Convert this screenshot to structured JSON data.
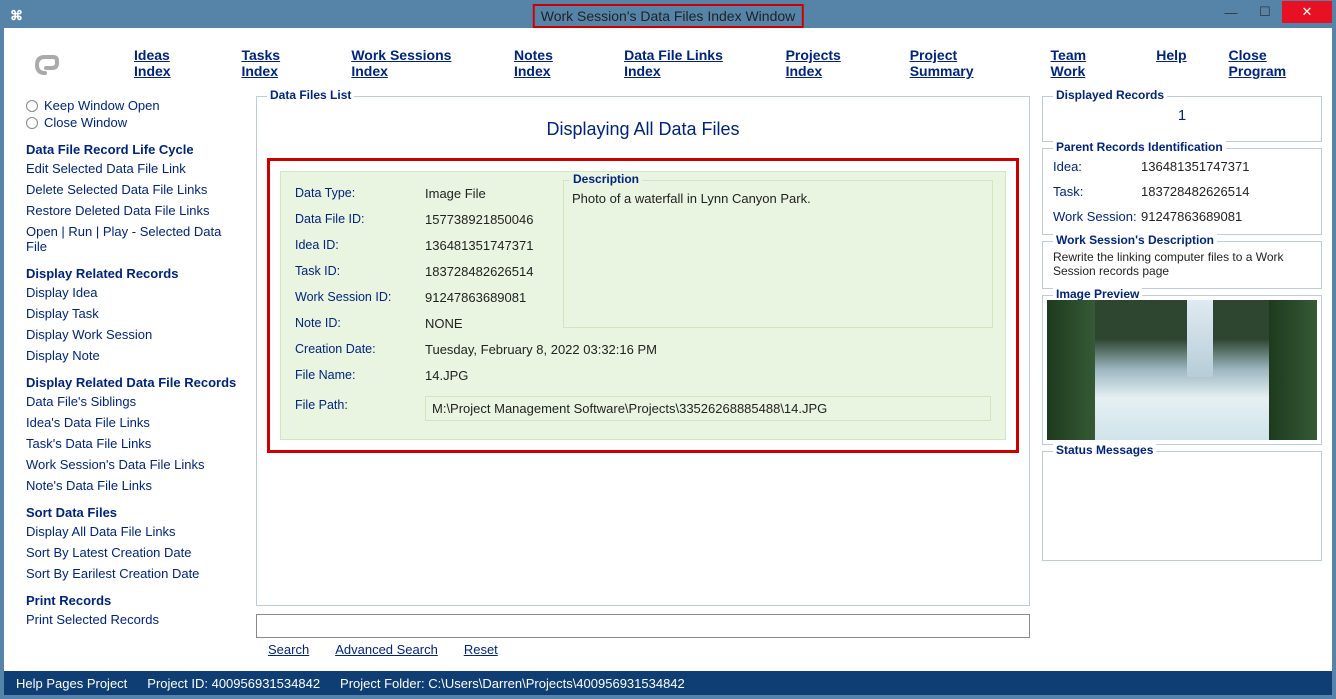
{
  "window": {
    "title": "Work Session's Data Files Index Window"
  },
  "menu": {
    "ideas": "Ideas Index",
    "tasks": "Tasks Index",
    "worksessions": "Work Sessions Index",
    "notes": "Notes Index",
    "datafilelinks": "Data File Links Index",
    "projects": "Projects Index",
    "projectsummary": "Project Summary",
    "teamwork": "Team Work",
    "help": "Help",
    "close": "Close Program"
  },
  "left": {
    "radio_keep": "Keep Window Open",
    "radio_close": "Close Window",
    "g1": "Data File Record Life Cycle",
    "g1_items": {
      "a": "Edit Selected Data File Link",
      "b": "Delete Selected Data File Links",
      "c": "Restore Deleted Data File Links",
      "d": "Open | Run | Play - Selected Data File"
    },
    "g2": "Display Related Records",
    "g2_items": {
      "a": "Display Idea",
      "b": "Display Task",
      "c": "Display Work Session",
      "d": "Display Note"
    },
    "g3": "Display Related Data File Records",
    "g3_items": {
      "a": "Data File's Siblings",
      "b": "Idea's Data File Links",
      "c": "Task's Data File Links",
      "d": "Work Session's Data File Links",
      "e": "Note's Data File Links"
    },
    "g4": "Sort Data Files",
    "g4_items": {
      "a": "Display All Data File Links",
      "b": "Sort By Latest Creation Date",
      "c": "Sort By Earilest Creation Date"
    },
    "g5": "Print Records",
    "g5_items": {
      "a": "Print Selected Records"
    }
  },
  "center": {
    "list_legend": "Data Files List",
    "heading": "Displaying All Data Files",
    "labels": {
      "datatype": "Data Type:",
      "datafileid": "Data File ID:",
      "ideaid": "Idea ID:",
      "taskid": "Task ID:",
      "wsid": "Work Session ID:",
      "noteid": "Note ID:",
      "creation": "Creation Date:",
      "filename": "File Name:",
      "filepath": "File Path:",
      "description": "Description"
    },
    "values": {
      "datatype": "Image File",
      "datafileid": "157738921850046",
      "ideaid": "136481351747371",
      "taskid": "183728482626514",
      "wsid": "91247863689081",
      "noteid": "NONE",
      "creation": "Tuesday, February 8, 2022   03:32:16 PM",
      "filename": "14.JPG",
      "filepath": "M:\\Project Management Software\\Projects\\33526268885488\\14.JPG",
      "description": "Photo of a waterfall in Lynn Canyon Park."
    },
    "search": "Search",
    "advsearch": "Advanced Search",
    "reset": "Reset"
  },
  "right": {
    "displayed_legend": "Displayed Records",
    "displayed_count": "1",
    "parent_legend": "Parent Records Identification",
    "parent": {
      "idea_k": "Idea:",
      "idea_v": "136481351747371",
      "task_k": "Task:",
      "task_v": "183728482626514",
      "ws_k": "Work Session:",
      "ws_v": "91247863689081"
    },
    "wsdesc_legend": "Work Session's Description",
    "wsdesc_text": "Rewrite the  linking computer files to a Work Session records page",
    "imgprev_legend": "Image Preview",
    "status_legend": "Status Messages"
  },
  "status": {
    "helppages": "Help Pages Project",
    "projectid_label": "Project ID:",
    "projectid": "400956931534842",
    "projectfolder_label": "Project Folder:",
    "projectfolder": "C:\\Users\\Darren\\Projects\\400956931534842"
  }
}
